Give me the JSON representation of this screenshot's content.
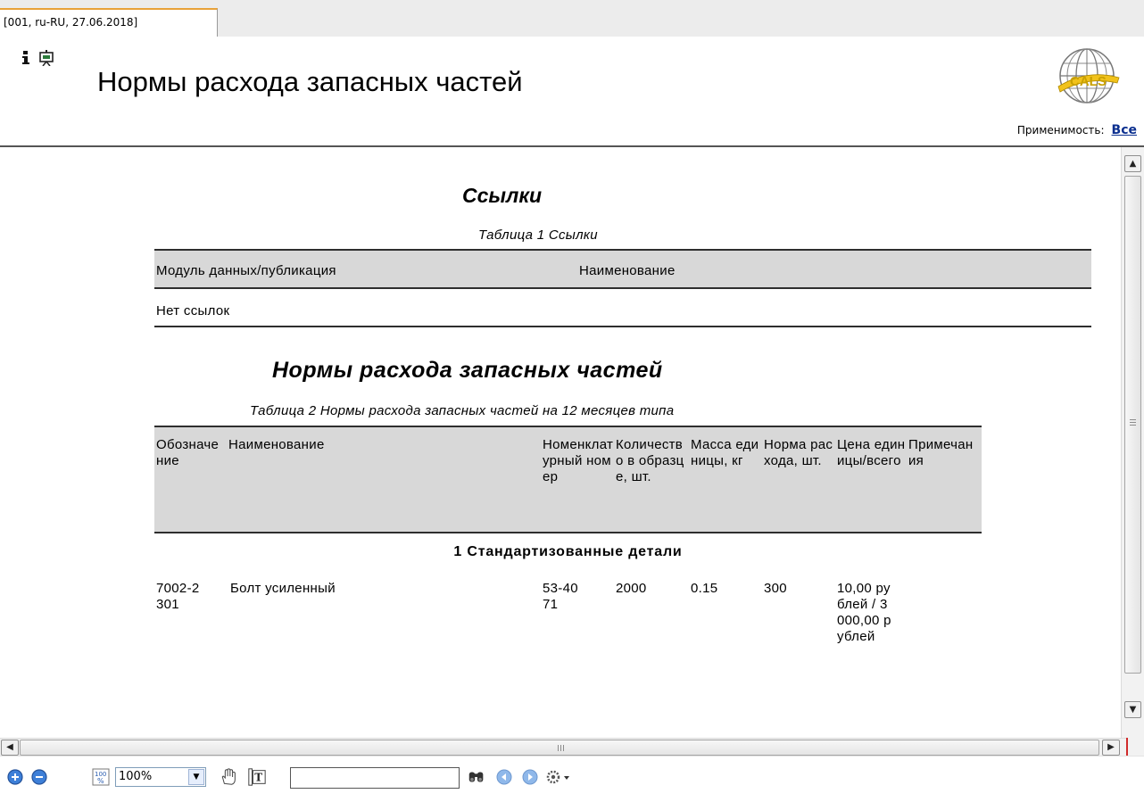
{
  "tab": {
    "label": "[001, ru-RU, 27.06.2018]"
  },
  "header": {
    "title": "Нормы расхода запасных частей",
    "logo_text": "CALS",
    "applicability_label": "Применимость:",
    "applicability_value": "Все",
    "icons": [
      "info-icon",
      "presentation-icon"
    ]
  },
  "doc": {
    "refs_heading": "Ссылки",
    "refs_caption": "Таблица 1   Ссылки",
    "refs_columns": [
      "Модуль данных/публикация",
      "Наименование"
    ],
    "refs_empty": "Нет ссылок",
    "parts_heading": "Нормы расхода запасных частей",
    "parts_caption": "Таблица 2   Нормы расхода запасных частей на 12 месяцев типа",
    "parts_columns": [
      "Обозначение",
      "Наименование",
      "Номенклатурный номер",
      "Количество в образце, шт.",
      "Масса единицы, кг",
      "Норма расхода, шт.",
      "Цена единицы/всего",
      "Примечания"
    ],
    "group_title": "1  Стандартизованные детали",
    "rows": [
      {
        "designation": "7002-2301",
        "name": "Болт усиленный",
        "nomenclature": "53-4071",
        "quantity": "2000",
        "mass": "0.15",
        "norm": "300",
        "price": "10,00 рублей / 3000,00 рублей",
        "notes": ""
      }
    ]
  },
  "toolbar": {
    "zoom_value": "100%",
    "search_value": "",
    "icons": [
      "zoom-in-icon",
      "zoom-out-icon",
      "fit-page-icon",
      "hand-tool-icon",
      "text-select-icon",
      "find-icon",
      "prev-result-icon",
      "next-result-icon",
      "settings-icon"
    ]
  },
  "colors": {
    "header_rule": "#555555",
    "table_header_bg": "#d8d8d8",
    "link": "#0b2f8f",
    "tab_accent": "#e8a23a"
  }
}
